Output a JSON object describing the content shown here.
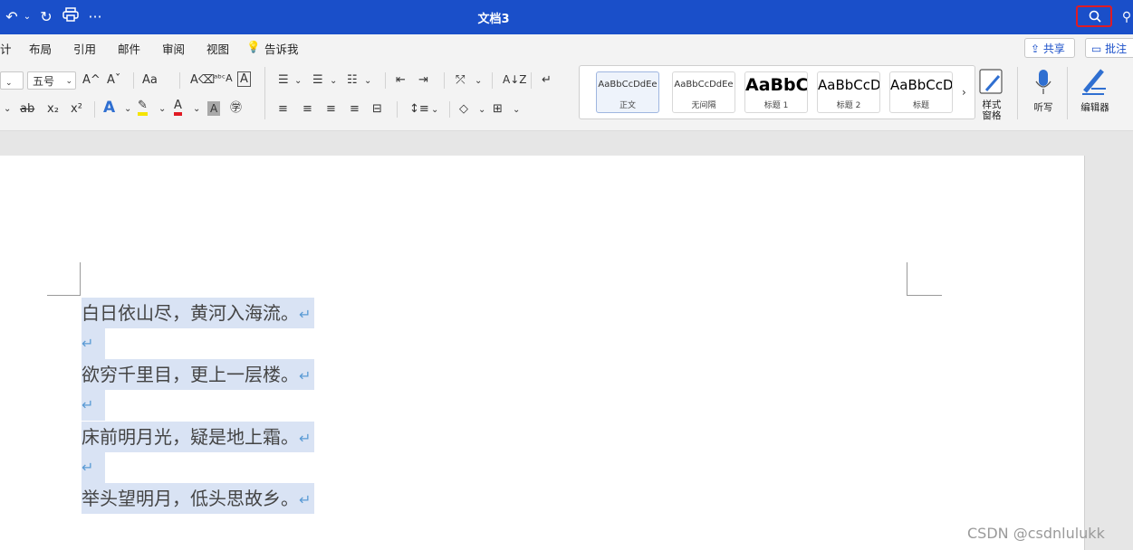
{
  "titlebar": {
    "title": "文档3",
    "undo_icon": "↶",
    "redo_icon": "↻",
    "more": "···"
  },
  "menu": [
    "计",
    "布局",
    "引用",
    "邮件",
    "审阅",
    "视图",
    "告诉我"
  ],
  "toolbar": {
    "font_size": "五号",
    "grow_font": "A^",
    "shrink_font": "Aˇ",
    "change_case": "Aa",
    "strikethrough": "ab",
    "subscript": "x₂",
    "superscript": "x²"
  },
  "gallery": {
    "styles": [
      {
        "preview": "AaBbCcDdEe",
        "name": "正文"
      },
      {
        "preview": "AaBbCcDdEe",
        "name": "无间隔"
      },
      {
        "preview": "AaBbC",
        "name": "标题 1"
      },
      {
        "preview": "AaBbCcD",
        "name": "标题 2"
      },
      {
        "preview": "AaBbCcD",
        "name": "标题"
      }
    ]
  },
  "right_tools": {
    "styles_pane": "样式窗格",
    "dictate": "听写",
    "editor": "编辑器",
    "share": "共享",
    "comment": "批注"
  },
  "document": {
    "lines": [
      "白日依山尽，黄河入海流。",
      "欲穷千里目，更上一层楼。",
      "床前明月光，疑是地上霜。",
      "举头望明月，低头思故乡。"
    ],
    "return_mark": "↵"
  },
  "watermark": "CSDN @csdnlulukk",
  "colors": {
    "titlebar": "#1a4fc9",
    "highlight": "#d9e3f4",
    "accent_red": "#e01b24"
  }
}
